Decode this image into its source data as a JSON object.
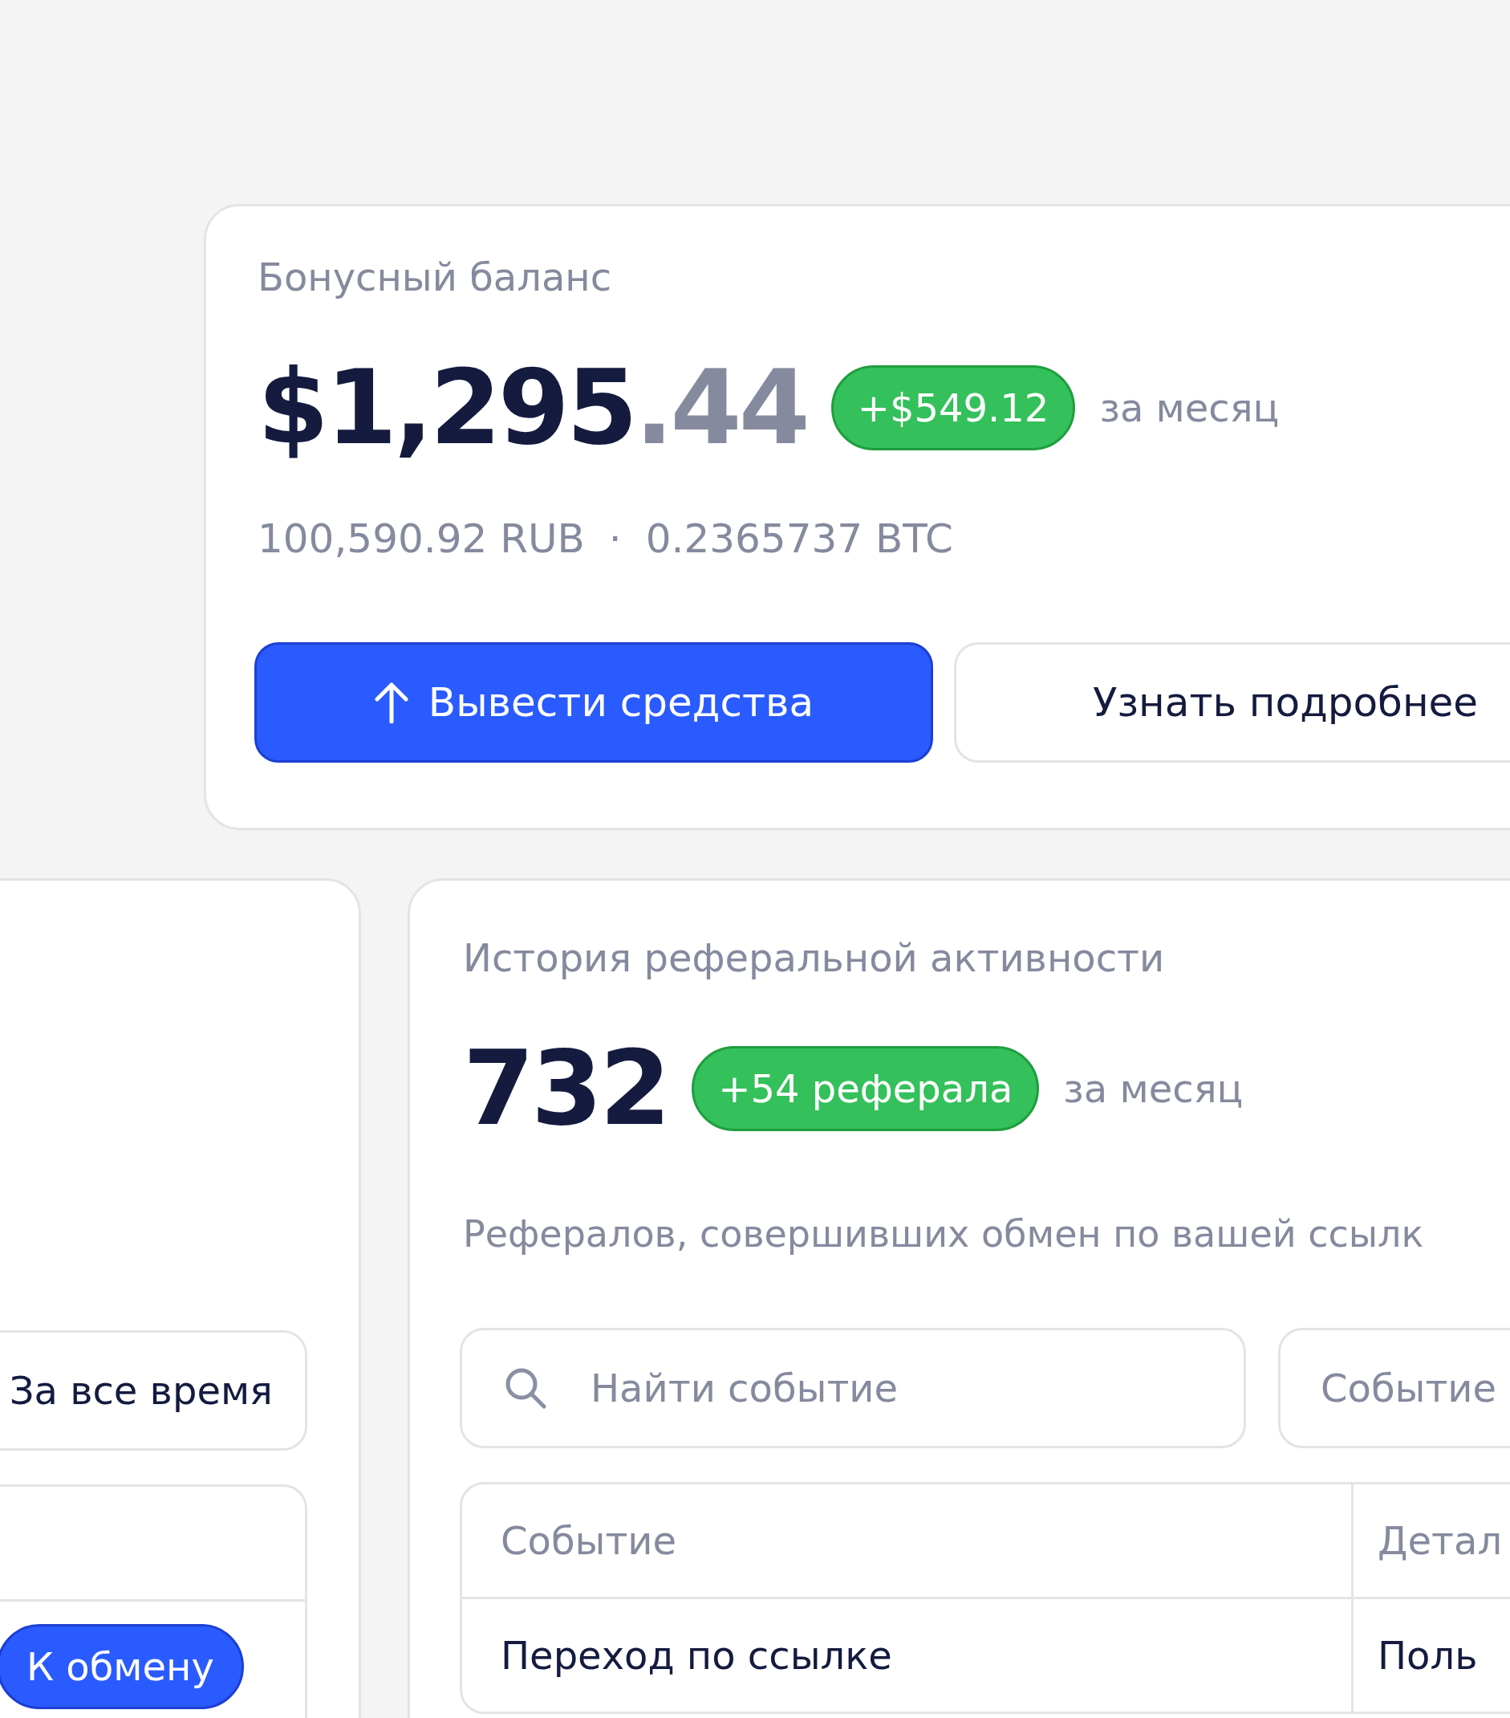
{
  "balance_card": {
    "title": "Бонусный баланс",
    "amount_main": "$1,295",
    "amount_cents": ".44",
    "change_badge": "+$549.12",
    "period": "за месяц",
    "rub": "100,590.92 RUB",
    "separator": "·",
    "btc": "0.2365737 BTC",
    "buttons": [
      {
        "kind": "primary",
        "label": "Вывести средства"
      },
      {
        "kind": "secondary",
        "label": "Узнать подробнее"
      }
    ]
  },
  "left_card": {
    "period_button": "За все время",
    "exchange_button": "К обмену"
  },
  "referral_card": {
    "title": "История реферальной активности",
    "count": "732",
    "change_badge": "+54 реферала",
    "period": "за месяц",
    "description": "Рефералов, совершивших обмен по вашей ссылк",
    "search": {
      "placeholder": "Найти событие"
    },
    "filter": "Событие",
    "table": {
      "columns": [
        "Событие",
        "Детал"
      ],
      "rows": [
        [
          "Переход по ссылке",
          "Поль"
        ]
      ]
    }
  }
}
